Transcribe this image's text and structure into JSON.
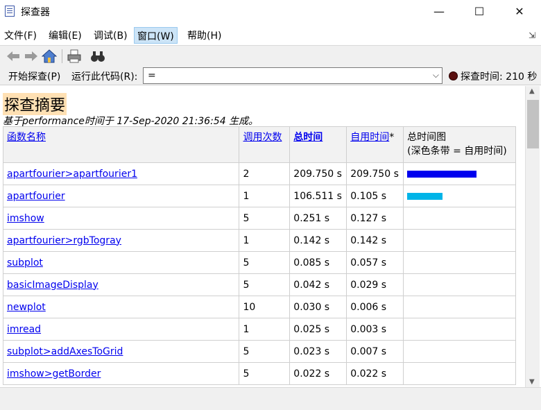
{
  "window": {
    "title": "探查器",
    "minimize_glyph": "—",
    "maximize_glyph": "☐",
    "close_glyph": "✕"
  },
  "menu": {
    "items": [
      {
        "label": "文件(F)"
      },
      {
        "label": "编辑(E)"
      },
      {
        "label": "调试(B)"
      },
      {
        "label": "窗口(W)"
      },
      {
        "label": "帮助(H)"
      }
    ],
    "overflow_glyph": "⇲"
  },
  "toolbar": {
    "icons": [
      "back-arrow-icon",
      "forward-arrow-icon",
      "home-icon",
      "print-icon",
      "find-icon"
    ]
  },
  "runbar": {
    "start_label": "开始探查(P)",
    "run_label": "运行此代码(R):",
    "code_value": "=",
    "status_text": "探查时间: 210 秒"
  },
  "summary": {
    "heading": "探查摘要",
    "subtitle": "基于performance时间于 17-Sep-2020 21:36:54 生成。",
    "columns": {
      "name": "函数名称",
      "calls": "调用次数",
      "total_time": "总时间",
      "self_time": "自用时间",
      "self_time_suffix": "*",
      "graph_line1": "总时间图",
      "graph_line2": "(深色条带 = 自用时间)"
    },
    "bar_colors": {
      "self": "#0000ee",
      "total": "#00b4e8"
    },
    "rows": [
      {
        "name": "apartfourier>apartfourier1",
        "calls": "2",
        "total": "209.750 s",
        "self": "209.750 s",
        "total_fraction": 1.0,
        "self_fraction": 1.0
      },
      {
        "name": "apartfourier",
        "calls": "1",
        "total": "106.511 s",
        "self": "0.105 s",
        "total_fraction": 0.51,
        "self_fraction": 0.0
      },
      {
        "name": "imshow",
        "calls": "5",
        "total": "0.251 s",
        "self": "0.127 s",
        "total_fraction": 0,
        "self_fraction": 0
      },
      {
        "name": "apartfourier>rgbTogray",
        "calls": "1",
        "total": "0.142 s",
        "self": "0.142 s",
        "total_fraction": 0,
        "self_fraction": 0
      },
      {
        "name": "subplot",
        "calls": "5",
        "total": "0.085 s",
        "self": "0.057 s",
        "total_fraction": 0,
        "self_fraction": 0
      },
      {
        "name": "basicImageDisplay",
        "calls": "5",
        "total": "0.042 s",
        "self": "0.029 s",
        "total_fraction": 0,
        "self_fraction": 0
      },
      {
        "name": "newplot",
        "calls": "10",
        "total": "0.030 s",
        "self": "0.006 s",
        "total_fraction": 0,
        "self_fraction": 0
      },
      {
        "name": "imread",
        "calls": "1",
        "total": "0.025 s",
        "self": "0.003 s",
        "total_fraction": 0,
        "self_fraction": 0
      },
      {
        "name": "subplot>addAxesToGrid",
        "calls": "5",
        "total": "0.023 s",
        "self": "0.007 s",
        "total_fraction": 0,
        "self_fraction": 0
      },
      {
        "name": "imshow>getBorder",
        "calls": "5",
        "total": "0.022 s",
        "self": "0.022 s",
        "total_fraction": 0,
        "self_fraction": 0
      }
    ]
  }
}
